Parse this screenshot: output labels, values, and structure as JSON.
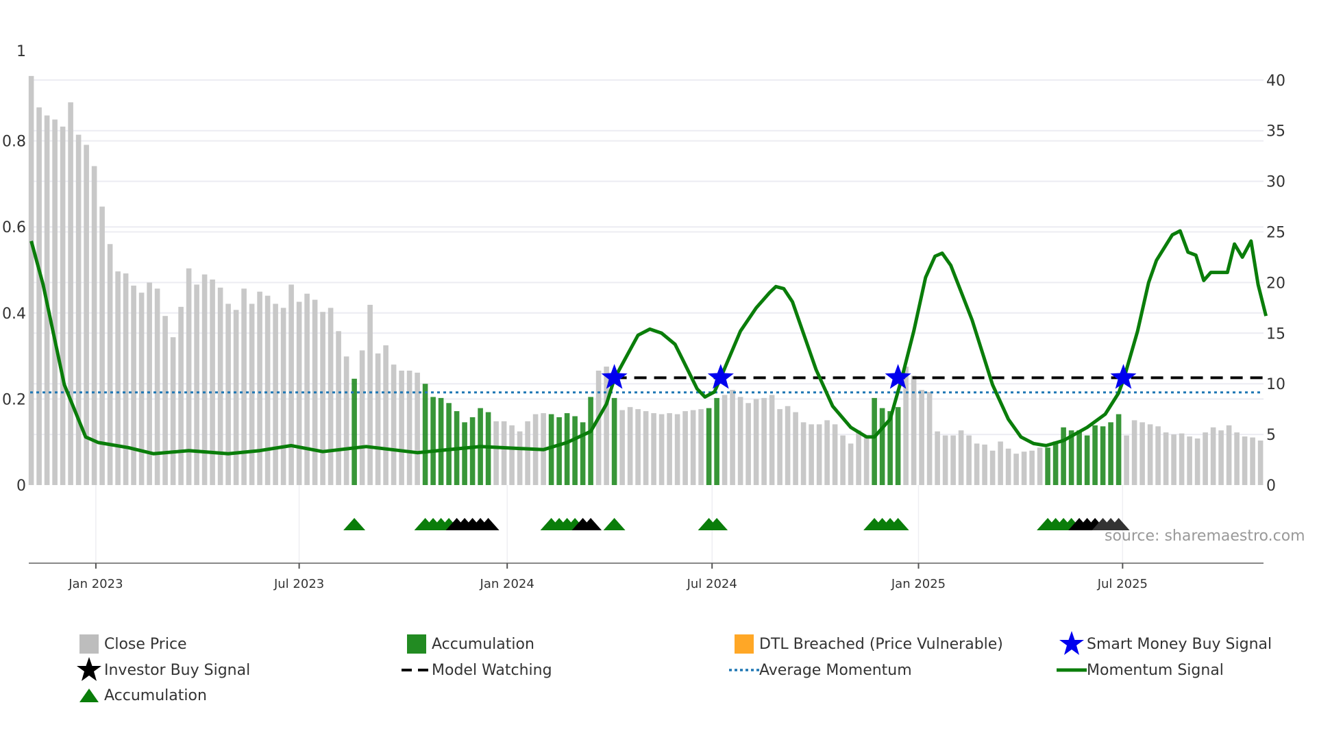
{
  "chart_data": {
    "type": "bar",
    "title": "",
    "x_unit": "week index",
    "x_ticks": [
      {
        "label": "Jan 2023",
        "pos": 8.2
      },
      {
        "label": "Jul 2023",
        "pos": 34.0
      },
      {
        "label": "Jan 2024",
        "pos": 60.4
      },
      {
        "label": "Jul 2024",
        "pos": 86.4
      },
      {
        "label": "Jan 2025",
        "pos": 112.6
      },
      {
        "label": "Jul 2025",
        "pos": 138.5
      }
    ],
    "left_axis": {
      "ticks": [
        "0",
        "0.2",
        "0.4",
        "0.6",
        "0.8",
        "1"
      ],
      "values": [
        0,
        0.2,
        0.4,
        0.6,
        0.8,
        1
      ],
      "ylim": [
        0,
        1
      ]
    },
    "right_axis": {
      "ticks": [
        "0",
        "5",
        "10",
        "15",
        "20",
        "25",
        "30",
        "35",
        "40"
      ],
      "values": [
        0,
        5,
        10,
        15,
        20,
        25,
        30,
        35,
        40
      ],
      "ylim": [
        0,
        40
      ]
    },
    "close_price": [
      40.4,
      37.3,
      36.5,
      36.1,
      35.4,
      37.8,
      34.6,
      33.6,
      31.5,
      27.5,
      23.8,
      21.1,
      20.9,
      19.7,
      19.0,
      20.0,
      19.4,
      16.7,
      14.6,
      17.6,
      21.4,
      19.8,
      20.8,
      20.3,
      19.5,
      17.9,
      17.3,
      19.4,
      17.9,
      19.1,
      18.7,
      17.9,
      17.5,
      19.8,
      18.1,
      18.9,
      18.3,
      17.1,
      17.5,
      15.2,
      12.7,
      10.5,
      13.3,
      17.8,
      13.0,
      13.8,
      11.9,
      11.3,
      11.3,
      11.1,
      10.0,
      8.7,
      8.6,
      8.1,
      7.3,
      6.2,
      6.7,
      7.6,
      7.2,
      6.3,
      6.3,
      5.9,
      5.3,
      6.3,
      7.0,
      7.1,
      7.0,
      6.7,
      7.1,
      6.8,
      6.2,
      8.7,
      11.3,
      11.7,
      8.6,
      7.4,
      7.7,
      7.5,
      7.3,
      7.1,
      7.0,
      7.1,
      7.0,
      7.3,
      7.4,
      7.5,
      7.6,
      8.6,
      8.9,
      9.4,
      8.7,
      8.1,
      8.5,
      8.6,
      8.9,
      7.5,
      7.8,
      7.2,
      6.2,
      6.0,
      6.0,
      6.4,
      6.0,
      4.9,
      4.1,
      5.4,
      4.9,
      8.6,
      7.6,
      7.3,
      7.7,
      11.7,
      10.8,
      9.4,
      9.2,
      5.3,
      4.9,
      4.9,
      5.4,
      4.9,
      4.1,
      4.0,
      3.4,
      4.3,
      3.6,
      3.1,
      3.3,
      3.4,
      3.7,
      3.7,
      4.3,
      5.7,
      5.4,
      5.4,
      4.9,
      5.9,
      5.8,
      6.2,
      7.0,
      4.9,
      6.4,
      6.2,
      6.0,
      5.8,
      5.2,
      5.0,
      5.1,
      4.8,
      4.6,
      5.2,
      5.7,
      5.4,
      5.9,
      5.2,
      4.8,
      4.7,
      4.4
    ],
    "accumulation_bar_indices": [
      41,
      50,
      51,
      52,
      53,
      54,
      55,
      56,
      57,
      58,
      66,
      67,
      68,
      69,
      70,
      71,
      74,
      86,
      87,
      107,
      108,
      109,
      110,
      129,
      130,
      131,
      132,
      133,
      134,
      135,
      136,
      137,
      138
    ],
    "momentum_signal": [
      [
        0,
        24.1
      ],
      [
        1.5,
        19.8
      ],
      [
        4.2,
        9.9
      ],
      [
        6.9,
        4.75
      ],
      [
        8.5,
        4.2
      ],
      [
        12.3,
        3.7
      ],
      [
        15.5,
        3.1
      ],
      [
        20,
        3.4
      ],
      [
        25,
        3.1
      ],
      [
        29,
        3.4
      ],
      [
        33,
        3.9
      ],
      [
        37,
        3.3
      ],
      [
        42.5,
        3.8
      ],
      [
        49,
        3.2
      ],
      [
        57,
        3.8
      ],
      [
        65,
        3.5
      ],
      [
        68,
        4.2
      ],
      [
        71,
        5.3
      ],
      [
        73,
        8.0
      ],
      [
        74,
        10.5
      ],
      [
        77,
        14.8
      ],
      [
        78.5,
        15.4
      ],
      [
        80,
        15.0
      ],
      [
        81.7,
        13.9
      ],
      [
        82.6,
        12.5
      ],
      [
        84.5,
        9.5
      ],
      [
        85.5,
        8.7
      ],
      [
        86.7,
        9.2
      ],
      [
        87.5,
        10.6
      ],
      [
        90,
        15.2
      ],
      [
        92,
        17.5
      ],
      [
        93.7,
        19.0
      ],
      [
        94.5,
        19.6
      ],
      [
        95.5,
        19.4
      ],
      [
        96.6,
        18.1
      ],
      [
        99.6,
        11.4
      ],
      [
        101.7,
        7.8
      ],
      [
        104,
        5.7
      ],
      [
        106,
        4.75
      ],
      [
        107,
        4.75
      ],
      [
        109,
        6.5
      ],
      [
        110.5,
        10.6
      ],
      [
        112,
        15.2
      ],
      [
        113.5,
        20.5
      ],
      [
        114.7,
        22.6
      ],
      [
        115.6,
        22.9
      ],
      [
        116.7,
        21.7
      ],
      [
        119.4,
        16.3
      ],
      [
        122,
        9.9
      ],
      [
        124,
        6.5
      ],
      [
        125.6,
        4.75
      ],
      [
        127.2,
        4.1
      ],
      [
        128.8,
        3.9
      ],
      [
        131,
        4.4
      ],
      [
        134,
        5.7
      ],
      [
        136.3,
        7.0
      ],
      [
        138,
        9.1
      ],
      [
        138.7,
        10.6
      ],
      [
        140.4,
        15.2
      ],
      [
        141.8,
        20.0
      ],
      [
        142.8,
        22.2
      ],
      [
        144.8,
        24.7
      ],
      [
        145.8,
        25.1
      ],
      [
        146.8,
        23.0
      ],
      [
        147.8,
        22.7
      ],
      [
        148.8,
        20.2
      ],
      [
        149.7,
        21.0
      ],
      [
        151.8,
        21.0
      ],
      [
        152.7,
        23.8
      ],
      [
        153.7,
        22.5
      ],
      [
        154.8,
        24.1
      ],
      [
        155.7,
        19.8
      ],
      [
        156.7,
        16.7
      ]
    ],
    "average_momentum": 9.15,
    "model_watching": {
      "level": 10.6,
      "from": 74
    },
    "smart_money_buy_signals": [
      [
        74,
        10.6
      ],
      [
        87.5,
        10.6
      ],
      [
        110,
        10.6
      ],
      [
        138.6,
        10.6
      ]
    ],
    "marker_triangles": [
      {
        "i": 41,
        "type": "accumulation"
      },
      {
        "i": 50,
        "type": "accumulation"
      },
      {
        "i": 51,
        "type": "accumulation"
      },
      {
        "i": 52,
        "type": "accumulation"
      },
      {
        "i": 53,
        "type": "accumulation"
      },
      {
        "i": 54,
        "type": "investor"
      },
      {
        "i": 55,
        "type": "investor"
      },
      {
        "i": 56,
        "type": "investor"
      },
      {
        "i": 57,
        "type": "investor"
      },
      {
        "i": 58,
        "type": "investor"
      },
      {
        "i": 66,
        "type": "accumulation"
      },
      {
        "i": 67,
        "type": "accumulation"
      },
      {
        "i": 68,
        "type": "accumulation"
      },
      {
        "i": 69,
        "type": "accumulation"
      },
      {
        "i": 70,
        "type": "investor"
      },
      {
        "i": 71,
        "type": "investor"
      },
      {
        "i": 74,
        "type": "accumulation"
      },
      {
        "i": 86,
        "type": "accumulation"
      },
      {
        "i": 87,
        "type": "accumulation"
      },
      {
        "i": 107,
        "type": "accumulation"
      },
      {
        "i": 108,
        "type": "accumulation"
      },
      {
        "i": 109,
        "type": "accumulation"
      },
      {
        "i": 110,
        "type": "accumulation"
      },
      {
        "i": 129,
        "type": "accumulation"
      },
      {
        "i": 130,
        "type": "accumulation"
      },
      {
        "i": 131,
        "type": "accumulation"
      },
      {
        "i": 132,
        "type": "accumulation"
      },
      {
        "i": 133,
        "type": "investor"
      },
      {
        "i": 134,
        "type": "investor"
      },
      {
        "i": 135,
        "type": "investor"
      },
      {
        "i": 136,
        "type": "investor-faded"
      },
      {
        "i": 137,
        "type": "investor-faded"
      },
      {
        "i": 138,
        "type": "investor-faded"
      }
    ],
    "legend": [
      {
        "label": "Close Price",
        "icon": "gray-square"
      },
      {
        "label": "Accumulation",
        "icon": "green-square"
      },
      {
        "label": "DTL Breached (Price Vulnerable)",
        "icon": "orange-square"
      },
      {
        "label": "Smart Money Buy Signal",
        "icon": "blue-star"
      },
      {
        "label": "Investor Buy Signal",
        "icon": "black-star"
      },
      {
        "label": "Model Watching",
        "icon": "black-dashed-line"
      },
      {
        "label": "Average Momentum",
        "icon": "blue-dotted-line"
      },
      {
        "label": "Momentum Signal",
        "icon": "green-line"
      },
      {
        "label": "Accumulation",
        "icon": "green-triangle"
      }
    ],
    "legend_position": "bottom",
    "grid": true
  },
  "source": "source: sharemaestro.com",
  "colors": {
    "price": "#c8c8c8",
    "accumulation": "#228b22",
    "dtl": "#ffa726",
    "smart_money": "#0000ee",
    "investor": "#000000",
    "avg_momentum": "#1f77b4",
    "momentum": "#0a7d0a"
  }
}
